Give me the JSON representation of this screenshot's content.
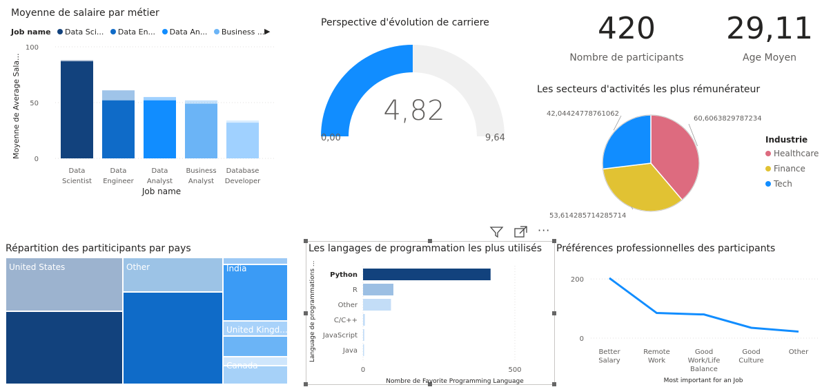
{
  "salary_chart": {
    "title": "Moyenne de salaire par métier",
    "legend_title": "Job name",
    "legend_items": [
      {
        "label": "Data Sci...",
        "color": "#12427d"
      },
      {
        "label": "Data En...",
        "color": "#0f6bc8"
      },
      {
        "label": "Data An...",
        "color": "#118dff"
      },
      {
        "label": "Business ...",
        "color": "#6bb4f6"
      }
    ],
    "more_arrow": "▶"
  },
  "gauge": {
    "title": "Perspective d'évolution de carriere",
    "value_label": "4,82",
    "min_label": "0,00",
    "max_label": "9,64",
    "value": 4.82,
    "min": 0,
    "max": 9.64,
    "fill_color": "#118dff",
    "track_color": "#f0f0f0"
  },
  "kpis": {
    "participants_value": "420",
    "participants_label": "Nombre de participants",
    "age_value": "29,11",
    "age_label": "Age Moyen"
  },
  "pie_chart": {
    "title": "Les secteurs d'activités les plus rémunérateur",
    "legend_title": "Industrie"
  },
  "treemap": {
    "title": "Répartition des partiticipants par pays"
  },
  "languages_chart": {
    "title": "Les langages de programmation les plus utilisés"
  },
  "preferences_chart": {
    "title": "Préférences professionnelles des participants"
  },
  "visual_header": {
    "filter_icon": "filter-icon",
    "focus_icon": "focus-mode-icon",
    "more_icon": "more-options-icon"
  },
  "chart_data": [
    {
      "type": "bar",
      "title": "Moyenne de salaire par métier",
      "xlabel": "Job name",
      "ylabel": "Moyenne de Average Sala...",
      "ylim": [
        0,
        100
      ],
      "yticks": [
        "0",
        "50",
        "100"
      ],
      "categories": [
        "Data Scientist",
        "Data Engineer",
        "Data Analyst",
        "Business Analyst",
        "Database Developer"
      ],
      "category_lines": [
        [
          "Data",
          "Scientist"
        ],
        [
          "Data",
          "Engineer"
        ],
        [
          "Data",
          "Analyst"
        ],
        [
          "Business",
          "Analyst"
        ],
        [
          "Database",
          "Developer"
        ]
      ],
      "values": [
        88,
        61,
        55,
        52,
        34
      ],
      "highlight_values": [
        87,
        52,
        52,
        49,
        32
      ],
      "colors": [
        "#12427d",
        "#0f6bc8",
        "#118dff",
        "#6bb4f6",
        "#a0d1ff"
      ],
      "grid": true,
      "legend": "top"
    },
    {
      "type": "pie",
      "title": "Les secteurs d'activités les plus rémunérateur",
      "legend_title": "Industrie",
      "legend": "right",
      "slices": [
        {
          "name": "Healthcare",
          "value": 60.6063829787234,
          "label": "60,6063829787234",
          "color": "#dd6b7f"
        },
        {
          "name": "Finance",
          "value": 53.614285714285714,
          "label": "53,614285714285714",
          "color": "#e1c233"
        },
        {
          "name": "Tech",
          "value": 42.04424778761062,
          "label": "42,04424778761062",
          "color": "#118dff"
        }
      ]
    },
    {
      "type": "treemap",
      "title": "Répartition des partiticipants par pays",
      "labels": [
        "United States",
        "Other",
        "India",
        "United Kingd...",
        "Canada"
      ]
    },
    {
      "type": "bar",
      "orientation": "horizontal",
      "title": "Les langages de programmation les plus utilisés",
      "xlabel": "Nombre de Favorite Programming Language",
      "ylabel": "Language de programmations ...",
      "categories": [
        "Python",
        "R",
        "Other",
        "C/C++",
        "JavaScript",
        "Java"
      ],
      "values": [
        420,
        100,
        92,
        6,
        4,
        2
      ],
      "xlim": [
        0,
        500
      ],
      "xticks": [
        "0",
        "500"
      ],
      "colors": [
        "#12427d",
        "#9cbfe3",
        "#c3ddf7",
        "#c3ddf7",
        "#c3ddf7",
        "#c3ddf7"
      ]
    },
    {
      "type": "line",
      "title": "Préférences professionnelles des participants",
      "xlabel": "Most important for an Job",
      "categories": [
        "Better Salary",
        "Remote Work",
        "Good Work/Life Balance",
        "Good Culture",
        "Other"
      ],
      "category_lines": [
        [
          "Better",
          "Salary"
        ],
        [
          "Remote",
          "Work"
        ],
        [
          "Good",
          "Work/Life",
          "Balance"
        ],
        [
          "Good",
          "Culture"
        ],
        [
          "Other"
        ]
      ],
      "values": [
        203,
        85,
        80,
        35,
        22
      ],
      "ylim": [
        0,
        240
      ],
      "yticks": [
        "0",
        "200"
      ],
      "color": "#118dff",
      "grid": true
    }
  ]
}
